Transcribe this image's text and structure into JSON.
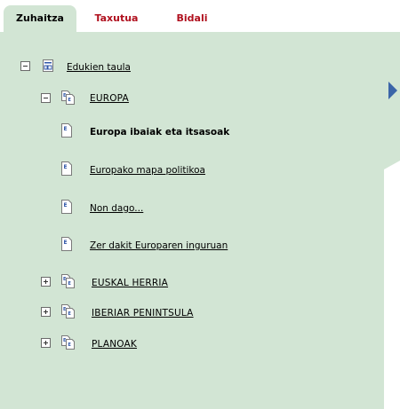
{
  "tabs": [
    {
      "label": "Zuhaitza",
      "active": true
    },
    {
      "label": "Taxutua",
      "active": false
    },
    {
      "label": "Bidali",
      "active": false
    }
  ],
  "tree": {
    "root": {
      "label": "Edukien taula",
      "icon": "table-of-contents-icon"
    },
    "europa": {
      "label": "EUROPA",
      "children": [
        {
          "label": "Europa ibaiak eta itsasoak",
          "selected": true
        },
        {
          "label": "Europako mapa politikoa"
        },
        {
          "label": "Non dago..."
        },
        {
          "label": "Zer dakit Europaren inguruan"
        }
      ]
    },
    "collapsed": [
      {
        "label": "EUSKAL HERRIA"
      },
      {
        "label": "IBERIAR PENINTSULA"
      },
      {
        "label": "PLANOAK"
      }
    ]
  },
  "colors": {
    "panel": "#d2e5d4",
    "tab_inactive": "#b0101e",
    "arrow": "#3b65a8"
  },
  "icons": [
    "minus-box-icon",
    "plus-box-icon",
    "document-icon",
    "document-group-icon",
    "table-of-contents-icon",
    "expand-arrow-icon"
  ]
}
